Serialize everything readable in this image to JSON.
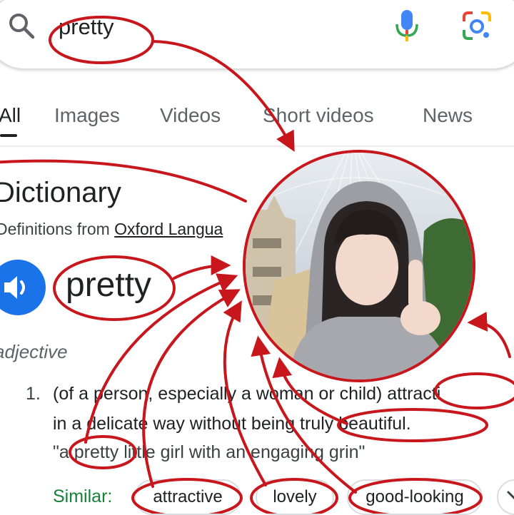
{
  "search": {
    "query": "pretty"
  },
  "tabs": [
    "All",
    "Images",
    "Videos",
    "Short videos",
    "News"
  ],
  "dictionary": {
    "title": "Dictionary",
    "definitions_from_prefix": "Definitions from ",
    "source": "Oxford Langua",
    "headword": "pretty",
    "part_of_speech": "adjective",
    "definition_number": "1.",
    "definition_line1": "(of a person, especially a woman or child) attracti",
    "definition_line2": "in a delicate way without being truly beautiful.",
    "example": "\"a pretty little girl with an engaging grin\"",
    "similar_label": "Similar:",
    "similar": [
      "attractive",
      "lovely",
      "good-looking"
    ]
  },
  "colors": {
    "annotation": "#c8161d",
    "google_blue": "#1a73e8",
    "similar_green": "#188038"
  }
}
